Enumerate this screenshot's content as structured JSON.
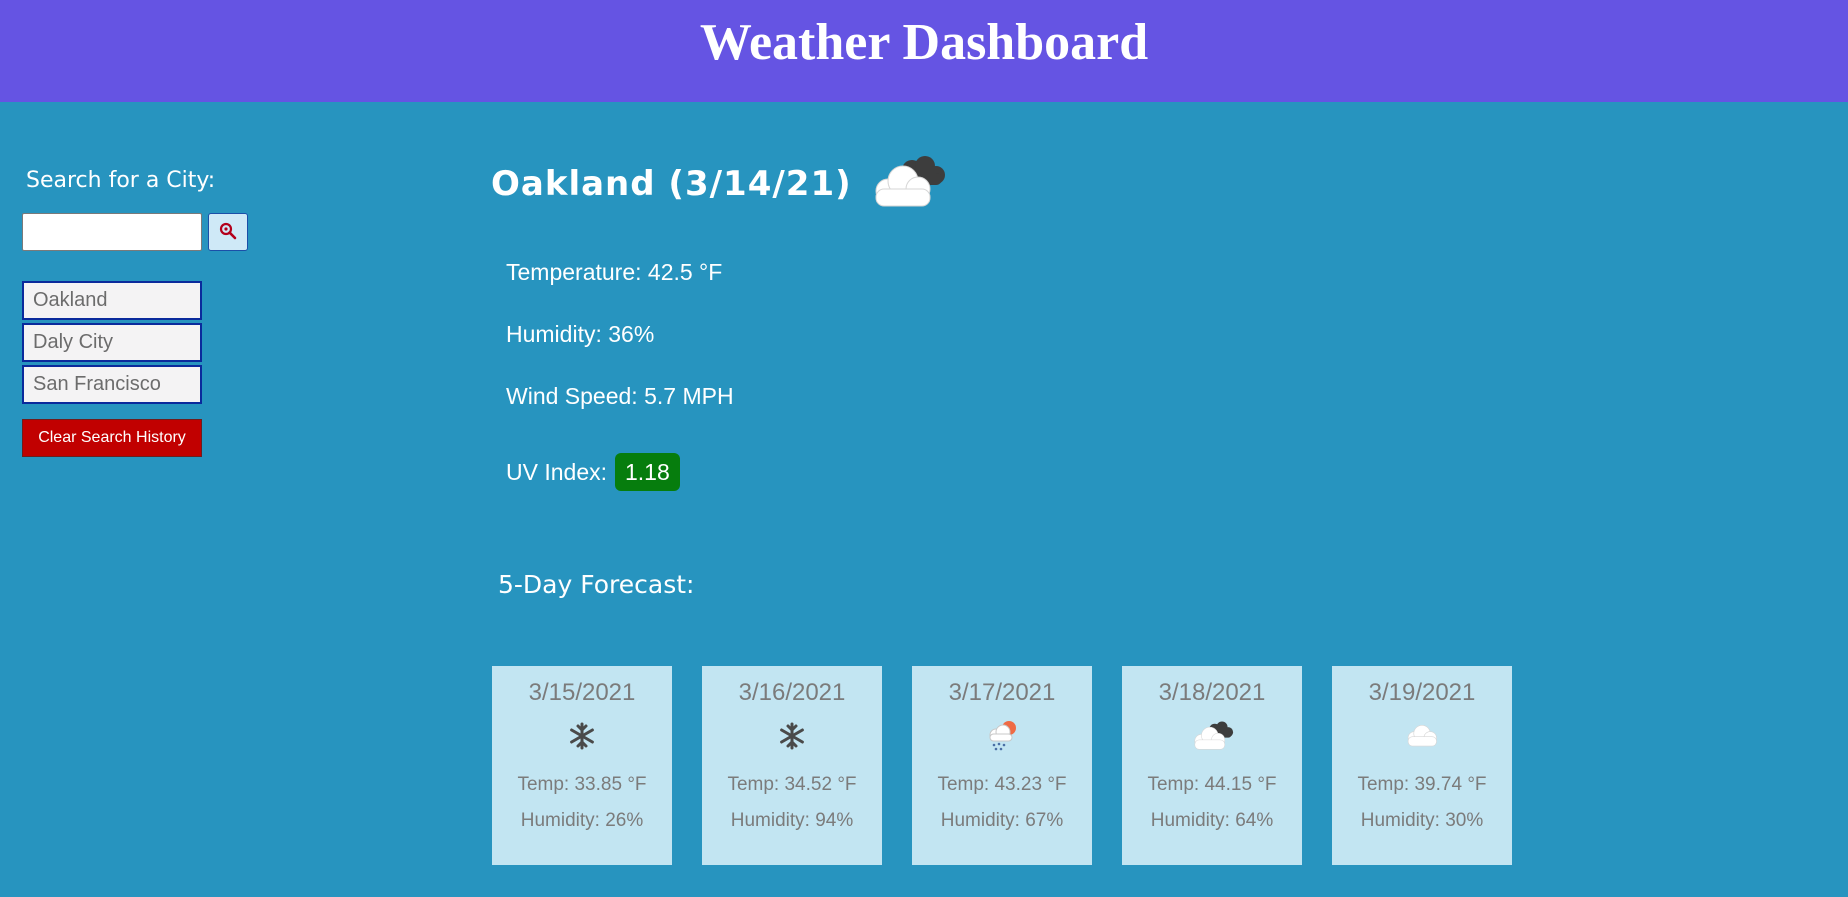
{
  "header": {
    "title": "Weather Dashboard"
  },
  "search": {
    "label": "Search for a City:",
    "value": "",
    "placeholder": "",
    "button_icon": "search-icon"
  },
  "history": {
    "items": [
      {
        "label": "Oakland"
      },
      {
        "label": "Daly City"
      },
      {
        "label": "San Francisco"
      }
    ],
    "clear_label": "Clear Search History"
  },
  "current": {
    "title": "Oakland (3/14/21)",
    "icon": "cloudy-icon",
    "temperature": "Temperature: 42.5 °F",
    "humidity": "Humidity: 36%",
    "wind": "Wind Speed: 5.7 MPH",
    "uv_label": "UV Index:",
    "uv_value": "1.18",
    "uv_color": "#067d0d"
  },
  "forecast": {
    "label": "5-Day Forecast:",
    "days": [
      {
        "date": "3/15/2021",
        "icon": "snow-icon",
        "temp": "Temp: 33.85 °F",
        "humidity": "Humidity: 26%"
      },
      {
        "date": "3/16/2021",
        "icon": "snow-icon",
        "temp": "Temp: 34.52 °F",
        "humidity": "Humidity: 94%"
      },
      {
        "date": "3/17/2021",
        "icon": "sun-snow-icon",
        "temp": "Temp: 43.23 °F",
        "humidity": "Humidity: 67%"
      },
      {
        "date": "3/18/2021",
        "icon": "cloudy-icon",
        "temp": "Temp: 44.15 °F",
        "humidity": "Humidity: 64%"
      },
      {
        "date": "3/19/2021",
        "icon": "cloud-icon",
        "temp": "Temp: 39.74 °F",
        "humidity": "Humidity: 30%"
      }
    ]
  },
  "colors": {
    "header_bg": "#6554e3",
    "page_bg": "#2794bf",
    "clear_button": "#c10000",
    "card_bg": "#c2e5f2"
  }
}
